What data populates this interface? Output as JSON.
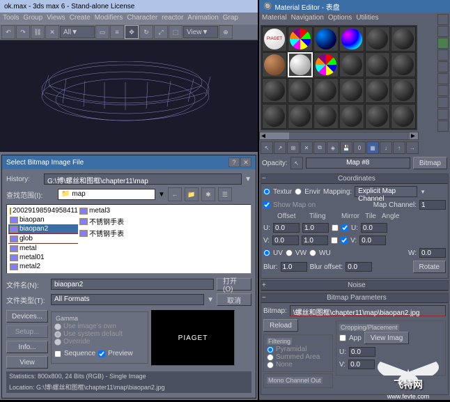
{
  "main": {
    "title": "ok.max - 3ds max 6 - Stand-alone License",
    "menu": [
      "Tools",
      "Group",
      "Views",
      "Create",
      "Modifiers",
      "Character",
      "reactor",
      "Animation",
      "Grap"
    ],
    "all_dropdown": "All",
    "view_btn": "View"
  },
  "dialog": {
    "title": "Select Bitmap Image File",
    "history_lbl": "History:",
    "history_val": "G:\\博\\螺丝和图框\\chapter11\\map",
    "lookin_lbl": "查找范围(I):",
    "lookin_val": "map",
    "files": [
      {
        "name": "20029198594958411",
        "type": "img"
      },
      {
        "name": "biaopan",
        "type": "img"
      },
      {
        "name": "biaopan2",
        "type": "img",
        "sel": true,
        "red": true
      },
      {
        "name": "glob",
        "type": "img",
        "red": true
      },
      {
        "name": "metal",
        "type": "img"
      },
      {
        "name": "metal01",
        "type": "img"
      },
      {
        "name": "metal2",
        "type": "img"
      },
      {
        "name": "metal3",
        "type": "img"
      },
      {
        "name": "不锈钢手表",
        "type": "img"
      },
      {
        "name": "不锈钢手表",
        "type": "img"
      }
    ],
    "filename_lbl": "文件名(N):",
    "filename_val": "biaopan2",
    "filetype_lbl": "文件类型(T):",
    "filetype_val": "All Formats",
    "open_btn": "打开(O)",
    "cancel_btn": "取消",
    "devices_btn": "Devices...",
    "setup_btn": "Setup...",
    "info_btn": "Info...",
    "view_btn": "View",
    "gamma_title": "Gamma",
    "gamma_own": "Use image's own",
    "gamma_sys": "Use system default",
    "gamma_over": "Override",
    "sequence_lbl": "Sequence",
    "preview_lbl": "Preview",
    "preview_text": "PIAGET",
    "stats": "Statistics:  800x800, 24 Bits (RGB) - Single Image",
    "location": "Location:  G:\\博\\螺丝和图框\\chapter11\\map\\biaopan2.jpg"
  },
  "mateditor": {
    "title": "Material Editor - 表盘",
    "menu": [
      "Material",
      "Navigation",
      "Options",
      "Utilities"
    ],
    "opacity_lbl": "Opacity:",
    "map_name": "Map #8",
    "map_type": "Bitmap",
    "coord_title": "Coordinates",
    "texture": "Textur",
    "envir": "Envir",
    "mapping_lbl": "Mapping:",
    "mapping_val": "Explicit Map Channel",
    "show_map": "Show Map on",
    "map_channel_lbl": "Map Channel:",
    "map_channel_val": "1",
    "offset_lbl": "Offset",
    "tiling_lbl": "Tiling",
    "mirror_lbl": "Mirror",
    "tile_lbl": "Tile",
    "angle_lbl": "Angle",
    "u_lbl": "U:",
    "v_lbl": "V:",
    "w_lbl": "W:",
    "u_off": "0.0",
    "u_til": "1.0",
    "u_ang": "0.0",
    "v_off": "0.0",
    "v_til": "1.0",
    "v_ang": "0.0",
    "w_ang": "0.0",
    "uv": "UV",
    "vw": "VW",
    "wu": "WU",
    "blur_lbl": "Blur:",
    "blur_val": "1.0",
    "bluroff_lbl": "Blur offset:",
    "bluroff_val": "0.0",
    "rotate_btn": "Rotate",
    "noise_title": "Noise",
    "bitmap_title": "Bitmap Parameters",
    "bitmap_lbl": "Bitmap:",
    "bitmap_path": "\\螺丝和图框\\chapter11\\map\\biaopan2.jpg",
    "reload_btn": "Reload",
    "crop_title": "Cropping/Placement",
    "apply": "App",
    "view_img": "View Imag",
    "filter_title": "Filtering",
    "pyramidal": "Pyramidal",
    "summed": "Summed Area",
    "none": "None",
    "mono_title": "Mono Channel Out",
    "crop_u": "0.0",
    "crop_v": "0.0"
  },
  "watermark": {
    "text": "飞特网",
    "url": "www.fevte.com"
  }
}
